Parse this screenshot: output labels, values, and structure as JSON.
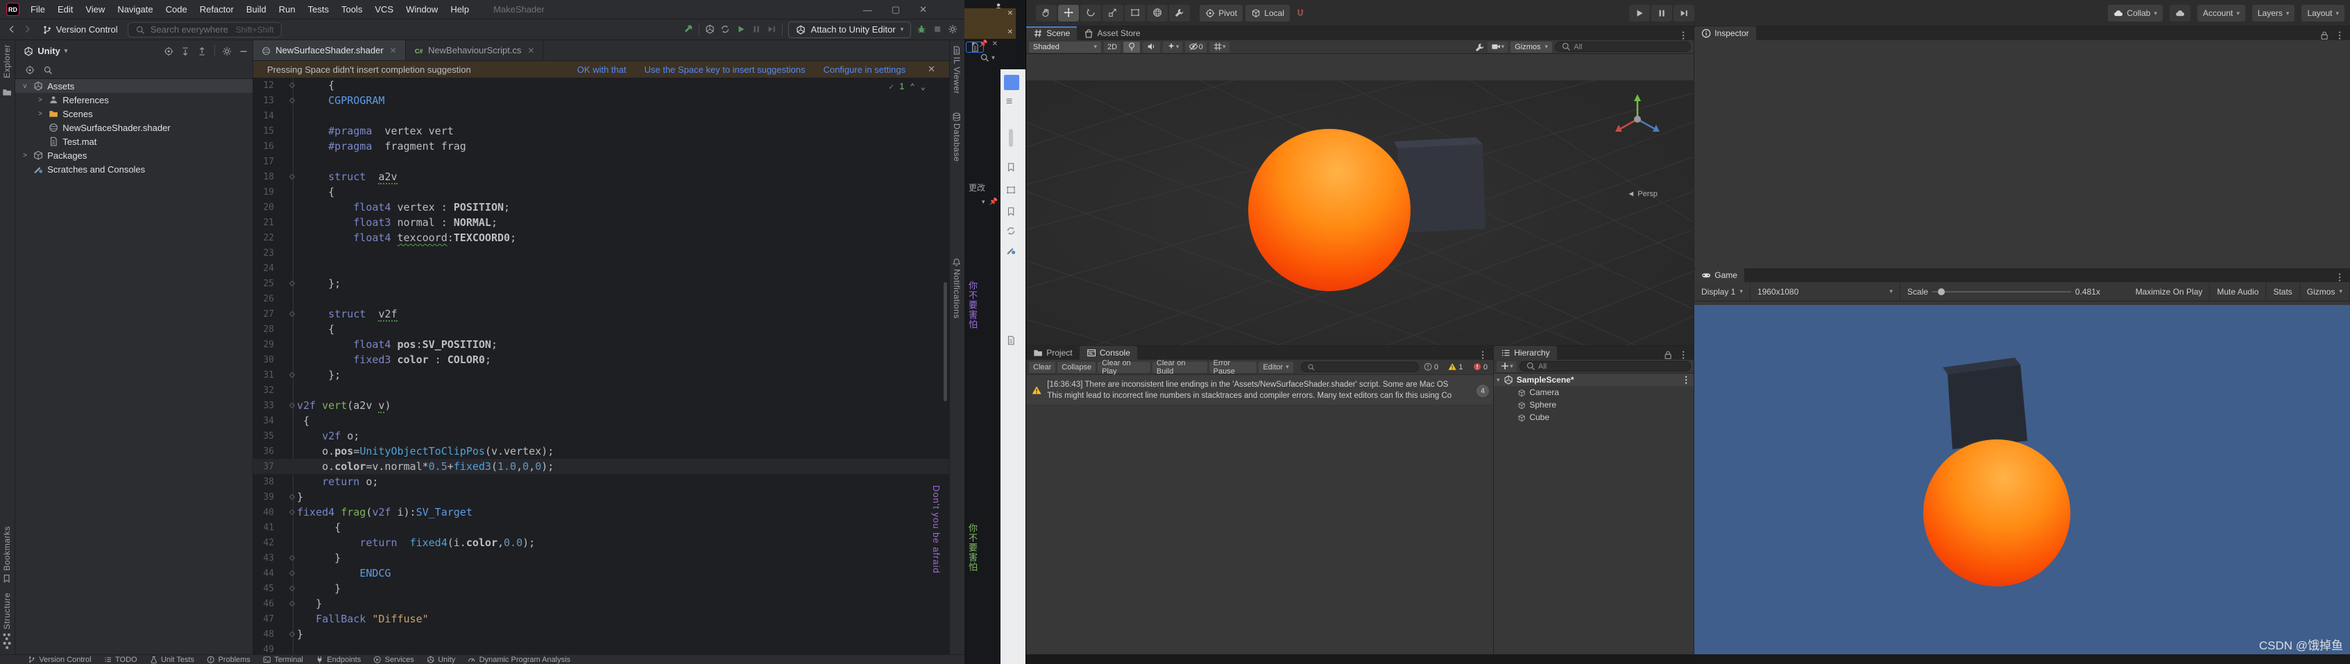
{
  "colors": {
    "accent": "#3574F0",
    "link": "#548AF7",
    "warn_yellow": "#FFC22E",
    "game_bg": "#3F5E8C",
    "sphere_orange": "#FF8A12",
    "sphere_red": "#E93007"
  },
  "rider": {
    "title_bar": {
      "logo": "RD",
      "menus": [
        "File",
        "Edit",
        "View",
        "Navigate",
        "Code",
        "Refactor",
        "Build",
        "Run",
        "Tests",
        "Tools",
        "VCS",
        "Window",
        "Help"
      ],
      "window_title": "MakeShader"
    },
    "toolbar": {
      "version_control": "Version Control",
      "search_placeholder": "Search everywhere",
      "search_shortcut": "Shift+Shift",
      "attach": "Attach to Unity Editor"
    },
    "left_stripe": {
      "top_label": "Explorer",
      "bottom_items": [
        {
          "label": "Bookmarks",
          "icon": "bookmark"
        },
        {
          "label": "Structure",
          "icon": "structure"
        }
      ]
    },
    "right_stripe": [
      {
        "label": "IL Viewer",
        "icon": "doc"
      },
      {
        "label": "Database",
        "icon": "db"
      },
      {
        "label": "Notifications",
        "icon": "bell"
      }
    ],
    "project": {
      "view_selector": "Unity",
      "tree": [
        {
          "label": "Assets",
          "icon": "unityAsset",
          "chev": "v",
          "level": 1,
          "selected": true
        },
        {
          "label": "References",
          "icon": "person",
          "chev": ">",
          "level": 2
        },
        {
          "label": "Scenes",
          "icon": "folder",
          "chev": ">",
          "level": 2,
          "icon_color": "#E8A33D"
        },
        {
          "label": "NewSurfaceShader.shader",
          "icon": "shader",
          "level": 2
        },
        {
          "label": "Test.mat",
          "icon": "doc",
          "level": 2
        },
        {
          "label": "Packages",
          "icon": "box",
          "chev": ">",
          "level": 1
        },
        {
          "label": "Scratches and Consoles",
          "icon": "scratch",
          "level": 1
        }
      ]
    },
    "tabs": [
      {
        "label": "NewSurfaceShader.shader",
        "icon": "shader",
        "active": true
      },
      {
        "label": "NewBehaviourScript.cs",
        "icon": "csharp"
      }
    ],
    "notification": {
      "message": "Pressing Space didn't insert completion suggestion",
      "actions": [
        "OK with that",
        "Use the Space key to insert suggestions",
        "Configure in settings"
      ]
    },
    "inspections": {
      "count": "1"
    },
    "code": {
      "lines": [
        {
          "n": 12,
          "f": 1,
          "t": [
            [
              "p",
              "     {"
            ]
          ]
        },
        {
          "n": 13,
          "f": 1,
          "t": [
            [
              "p",
              "     "
            ],
            [
              "b",
              "CGPROGRAM"
            ]
          ]
        },
        {
          "n": 14,
          "t": []
        },
        {
          "n": 15,
          "t": [
            [
              "p",
              "     "
            ],
            [
              "k",
              "#pragma"
            ],
            [
              "p",
              "  vertex vert"
            ]
          ]
        },
        {
          "n": 16,
          "t": [
            [
              "p",
              "     "
            ],
            [
              "k",
              "#pragma"
            ],
            [
              "p",
              "  fragment frag"
            ]
          ]
        },
        {
          "n": 17,
          "t": []
        },
        {
          "n": 18,
          "f": 1,
          "t": [
            [
              "p",
              "     "
            ],
            [
              "k",
              "struct"
            ],
            [
              "p",
              "  "
            ],
            [
              "u",
              "a2v"
            ]
          ]
        },
        {
          "n": 19,
          "t": [
            [
              "p",
              "     {"
            ]
          ]
        },
        {
          "n": 20,
          "t": [
            [
              "p",
              "         "
            ],
            [
              "k",
              "float4"
            ],
            [
              "p",
              " vertex : "
            ],
            [
              "m",
              "POSITION"
            ],
            [
              "p",
              ";"
            ]
          ]
        },
        {
          "n": 21,
          "t": [
            [
              "p",
              "         "
            ],
            [
              "k",
              "float3"
            ],
            [
              "p",
              " normal : "
            ],
            [
              "m",
              "NORMAL"
            ],
            [
              "p",
              ";"
            ]
          ]
        },
        {
          "n": 22,
          "t": [
            [
              "p",
              "         "
            ],
            [
              "k",
              "float4"
            ],
            [
              "p",
              " "
            ],
            [
              "q",
              "texcoord"
            ],
            [
              "p",
              ":"
            ],
            [
              "m",
              "TEXCOORD0"
            ],
            [
              "p",
              ";"
            ]
          ]
        },
        {
          "n": 23,
          "t": []
        },
        {
          "n": 24,
          "t": []
        },
        {
          "n": 25,
          "f": 1,
          "t": [
            [
              "p",
              "     };"
            ]
          ]
        },
        {
          "n": 26,
          "t": []
        },
        {
          "n": 27,
          "f": 1,
          "t": [
            [
              "p",
              "     "
            ],
            [
              "k",
              "struct"
            ],
            [
              "p",
              "  "
            ],
            [
              "u",
              "v2f"
            ]
          ]
        },
        {
          "n": 28,
          "t": [
            [
              "p",
              "     {"
            ]
          ]
        },
        {
          "n": 29,
          "t": [
            [
              "p",
              "         "
            ],
            [
              "k",
              "float4"
            ],
            [
              "p",
              " "
            ],
            [
              "m",
              "pos"
            ],
            [
              "p",
              ":"
            ],
            [
              "m",
              "SV_POSITION"
            ],
            [
              "p",
              ";"
            ]
          ]
        },
        {
          "n": 30,
          "t": [
            [
              "p",
              "         "
            ],
            [
              "k",
              "fixed3"
            ],
            [
              "p",
              " "
            ],
            [
              "m",
              "color"
            ],
            [
              "p",
              " : "
            ],
            [
              "m",
              "COLOR0"
            ],
            [
              "p",
              ";"
            ]
          ]
        },
        {
          "n": 31,
          "f": 1,
          "t": [
            [
              "p",
              "     };"
            ]
          ]
        },
        {
          "n": 32,
          "t": []
        },
        {
          "n": 33,
          "f": 1,
          "t": [
            [
              "k",
              "v2f"
            ],
            [
              "p",
              " "
            ],
            [
              "fn",
              "vert"
            ],
            [
              "p",
              "("
            ],
            [
              "p",
              "a2v "
            ],
            [
              "u",
              "v"
            ],
            [
              "p",
              ")"
            ]
          ]
        },
        {
          "n": 34,
          "t": [
            [
              "p",
              " {"
            ]
          ]
        },
        {
          "n": 35,
          "t": [
            [
              "p",
              "    "
            ],
            [
              "k",
              "v2f"
            ],
            [
              "p",
              " o;"
            ]
          ]
        },
        {
          "n": 36,
          "t": [
            [
              "p",
              "    o."
            ],
            [
              "m",
              "pos"
            ],
            [
              "p",
              "="
            ],
            [
              "c",
              "UnityObjectToClipPos"
            ],
            [
              "p",
              "(v.vertex);"
            ]
          ]
        },
        {
          "n": 37,
          "cur": 1,
          "t": [
            [
              "p",
              "    o."
            ],
            [
              "m",
              "color"
            ],
            [
              "p",
              "=v.normal*"
            ],
            [
              "num",
              "0.5"
            ],
            [
              "p",
              "+"
            ],
            [
              "c",
              "fixed3"
            ],
            [
              "p",
              "("
            ],
            [
              "num",
              "1.0"
            ],
            [
              "p",
              ","
            ],
            [
              "num",
              "0"
            ],
            [
              "p",
              ","
            ],
            [
              "num",
              "0"
            ],
            [
              "p",
              ");"
            ]
          ]
        },
        {
          "n": 38,
          "t": [
            [
              "p",
              "    "
            ],
            [
              "k",
              "return"
            ],
            [
              "p",
              " o;"
            ]
          ]
        },
        {
          "n": 39,
          "f": 1,
          "t": [
            [
              "p",
              "}"
            ]
          ]
        },
        {
          "n": 40,
          "f": 1,
          "t": [
            [
              "k",
              "fixed4"
            ],
            [
              "p",
              " "
            ],
            [
              "fn",
              "frag"
            ],
            [
              "p",
              "("
            ],
            [
              "k",
              "v2f"
            ],
            [
              "p",
              " i):"
            ],
            [
              "b",
              "SV_Target"
            ]
          ]
        },
        {
          "n": 41,
          "t": [
            [
              "p",
              "      {"
            ]
          ]
        },
        {
          "n": 42,
          "t": [
            [
              "p",
              "          "
            ],
            [
              "k",
              "return"
            ],
            [
              "p",
              "  "
            ],
            [
              "c",
              "fixed4"
            ],
            [
              "p",
              "(i."
            ],
            [
              "m",
              "color"
            ],
            [
              "p",
              ","
            ],
            [
              "num",
              "0.0"
            ],
            [
              "p",
              ");"
            ]
          ]
        },
        {
          "n": 43,
          "f": 1,
          "t": [
            [
              "p",
              "      }"
            ]
          ]
        },
        {
          "n": 44,
          "f": 1,
          "t": [
            [
              "p",
              "          "
            ],
            [
              "b",
              "ENDCG"
            ]
          ]
        },
        {
          "n": 45,
          "f": 1,
          "t": [
            [
              "p",
              "      }"
            ]
          ]
        },
        {
          "n": 46,
          "f": 1,
          "t": [
            [
              "p",
              "   }"
            ]
          ]
        },
        {
          "n": 47,
          "t": [
            [
              "p",
              "   "
            ],
            [
              "k",
              "FallBack"
            ],
            [
              "p",
              " "
            ],
            [
              "s",
              "\"Diffuse\""
            ]
          ]
        },
        {
          "n": 48,
          "f": 1,
          "t": [
            [
              "p",
              "}"
            ]
          ]
        },
        {
          "n": 49,
          "t": []
        }
      ]
    },
    "status_bar": [
      {
        "label": "Version Control",
        "icon": "branch"
      },
      {
        "label": "TODO",
        "icon": "todo"
      },
      {
        "label": "Unit Tests",
        "icon": "flask"
      },
      {
        "label": "Problems",
        "icon": "infoC"
      },
      {
        "label": "Terminal",
        "icon": "terminal"
      },
      {
        "label": "Endpoints",
        "icon": "plug"
      },
      {
        "label": "Services",
        "icon": "servPlay"
      },
      {
        "label": "Unity",
        "icon": "unity"
      },
      {
        "label": "Dynamic Program Analysis",
        "icon": "gauge"
      }
    ]
  },
  "lyrics": {
    "english": "Don't you be afraid",
    "chinese_line1": "你不要害怕",
    "chinese_line2": "你不要害怕"
  },
  "strip": {
    "changes_label": "更改"
  },
  "unity": {
    "toolbar": {
      "tools": [
        "hand",
        "move",
        "rotate",
        "scaleT",
        "rectT",
        "sphereT",
        "wrench"
      ],
      "selected_tool": 1,
      "pivot": "Pivot",
      "local": "Local",
      "collab": "Collab",
      "account": "Account",
      "layers": "Layers",
      "layout": "Layout"
    },
    "scene": {
      "tabs": [
        "Scene",
        "Asset Store"
      ],
      "shading": "Shaded",
      "toggle_2d": "2D",
      "vis_count": "0",
      "gizmos": "Gizmos",
      "search": "All",
      "persp": "Persp"
    },
    "inspector": {
      "tab": "Inspector"
    },
    "game": {
      "tab": "Game",
      "display": "Display 1",
      "resolution": "1960x1080",
      "scale_label": "Scale",
      "scale_value": "0.481x",
      "buttons": [
        "Maximize On Play",
        "Mute Audio",
        "Stats"
      ],
      "gizmos": "Gizmos"
    },
    "console": {
      "tabs": [
        "Project",
        "Console"
      ],
      "buttons": [
        "Clear",
        "Collapse",
        "Clear on Play",
        "Clear on Build",
        "Error Pause"
      ],
      "editor_dd": "Editor",
      "counts": {
        "info": "0",
        "warn": "1",
        "error": "0"
      },
      "entry": {
        "line1": "[16:36:43] There are inconsistent line endings in the 'Assets/NewSurfaceShader.shader' script. Some are Mac OS",
        "line2": "This might lead to incorrect line numbers in stacktraces and compiler errors. Many text editors can fix this using Co",
        "badge": "4"
      }
    },
    "hierarchy": {
      "tab": "Hierarchy",
      "search": "All",
      "root": "SampleScene*",
      "children": [
        "Camera",
        "Sphere",
        "Cube"
      ]
    }
  },
  "watermark": "CSDN @饿掉鱼"
}
